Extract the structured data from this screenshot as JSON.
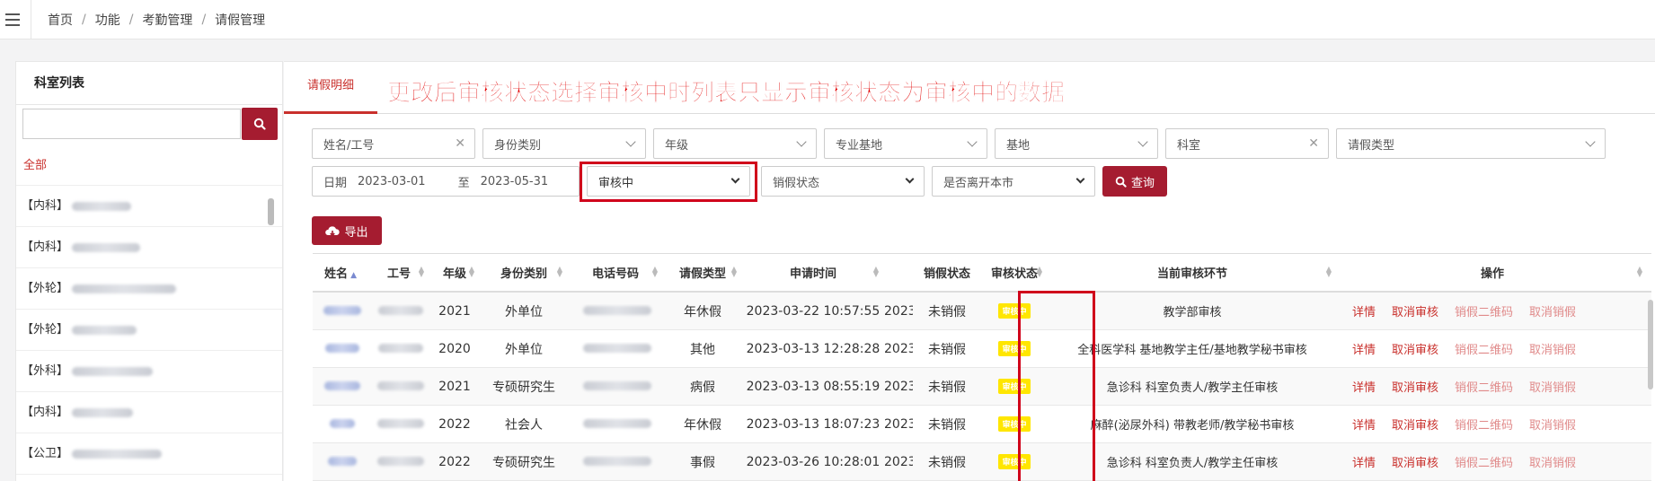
{
  "breadcrumb": [
    "首页",
    "功能",
    "考勤管理",
    "请假管理"
  ],
  "sidebar": {
    "title": "科室列表",
    "search_value": "",
    "all_label": "全部",
    "items": [
      {
        "tag": "【内科】"
      },
      {
        "tag": "【内科】"
      },
      {
        "tag": "【外轮】"
      },
      {
        "tag": "【外轮】"
      },
      {
        "tag": "【外科】"
      },
      {
        "tag": "【内科】"
      },
      {
        "tag": "【公卫】"
      }
    ]
  },
  "tab": {
    "label": "请假明细"
  },
  "annotation": "更改后审核状态选择审核中时列表只显示审核状态为审核中的数据",
  "filters": {
    "name_placeholder": "姓名/工号",
    "identity": "身份类别",
    "grade": "年级",
    "specialty_base": "专业基地",
    "base": "基地",
    "department": "科室",
    "leave_type": "请假类型",
    "date_label": "日期",
    "date_from": "2023-03-01",
    "date_to_label": "至",
    "date_to": "2023-05-31",
    "audit_status": "审核中",
    "cancel_status": "销假状态",
    "leave_city": "是否离开本市",
    "query_label": "查询",
    "export_label": "导出"
  },
  "table": {
    "headers": [
      "姓名",
      "工号",
      "年级",
      "身份类别",
      "电话号码",
      "请假类型",
      "申请时间",
      "",
      "销假状态",
      "审核状态",
      "当前审核环节",
      "操作"
    ],
    "rows": [
      {
        "grade": "2021",
        "identity": "外单位",
        "type": "年休假",
        "time": "2023-03-22 10:57:55",
        "extra": "2023",
        "cancel": "未销假",
        "status": "审核中",
        "stage": "教学部审核"
      },
      {
        "grade": "2020",
        "identity": "外单位",
        "type": "其他",
        "time": "2023-03-13 12:28:28",
        "extra": "2023",
        "cancel": "未销假",
        "status": "审核中",
        "stage": "全科医学科 基地教学主任/基地教学秘书审核"
      },
      {
        "grade": "2021",
        "identity": "专硕研究生",
        "type": "病假",
        "time": "2023-03-13 08:55:19",
        "extra": "2023",
        "cancel": "未销假",
        "status": "审核中",
        "stage": "急诊科 科室负责人/教学主任审核"
      },
      {
        "grade": "2022",
        "identity": "社会人",
        "type": "年休假",
        "time": "2023-03-13 18:07:23",
        "extra": "2023",
        "cancel": "未销假",
        "status": "审核中",
        "stage": "麻醉(泌尿外科) 带教老师/教学秘书审核"
      },
      {
        "grade": "2022",
        "identity": "专硕研究生",
        "type": "事假",
        "time": "2023-03-26 10:28:01",
        "extra": "2023",
        "cancel": "未销假",
        "status": "审核中",
        "stage": "急诊科 科室负责人/教学主任审核"
      }
    ],
    "ops": [
      "详情",
      "取消审核",
      "销假二维码",
      "取消销假"
    ]
  }
}
